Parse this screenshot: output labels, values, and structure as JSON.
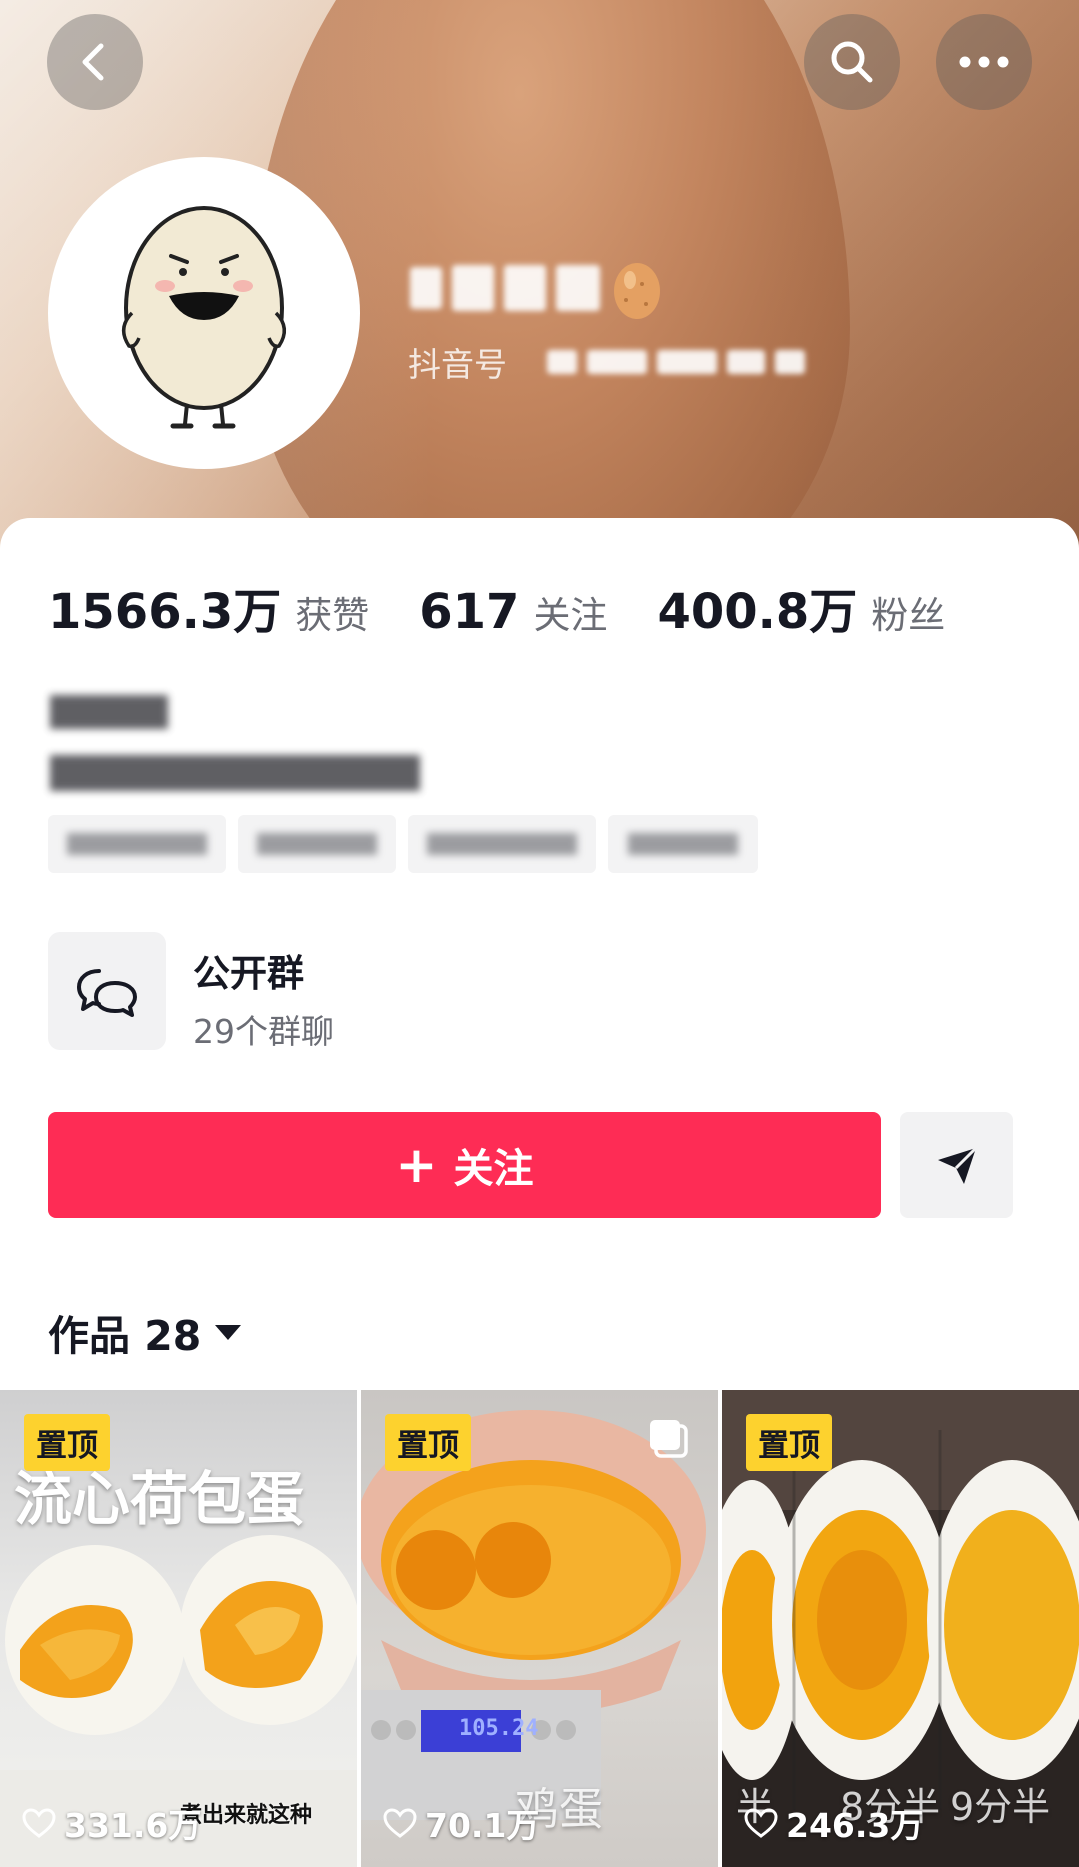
{
  "profile": {
    "douyin_id_label": "抖音号",
    "stats": [
      {
        "value": "1566.3万",
        "label": "获赞"
      },
      {
        "value": "617",
        "label": "关注"
      },
      {
        "value": "400.8万",
        "label": "粉丝"
      }
    ]
  },
  "group": {
    "title": "公开群",
    "subtitle": "29个群聊"
  },
  "actions": {
    "follow_plus": "+",
    "follow_label": "关注"
  },
  "works": {
    "label": "作品 28"
  },
  "videos": [
    {
      "pin": "置顶",
      "likes": "331.6万",
      "title_overlay": "流心荷包蛋",
      "caption_overlay": "煮出来就这种"
    },
    {
      "pin": "置顶",
      "likes": "70.1万",
      "caption_overlay": "鸡蛋",
      "scale_reading": "105.24"
    },
    {
      "pin": "置顶",
      "likes": "246.3万",
      "labels_overlay": [
        "半",
        "8分半",
        "9分半"
      ]
    }
  ],
  "colors": {
    "accent": "#fe2c55",
    "pin_badge": "#fdd22e"
  }
}
